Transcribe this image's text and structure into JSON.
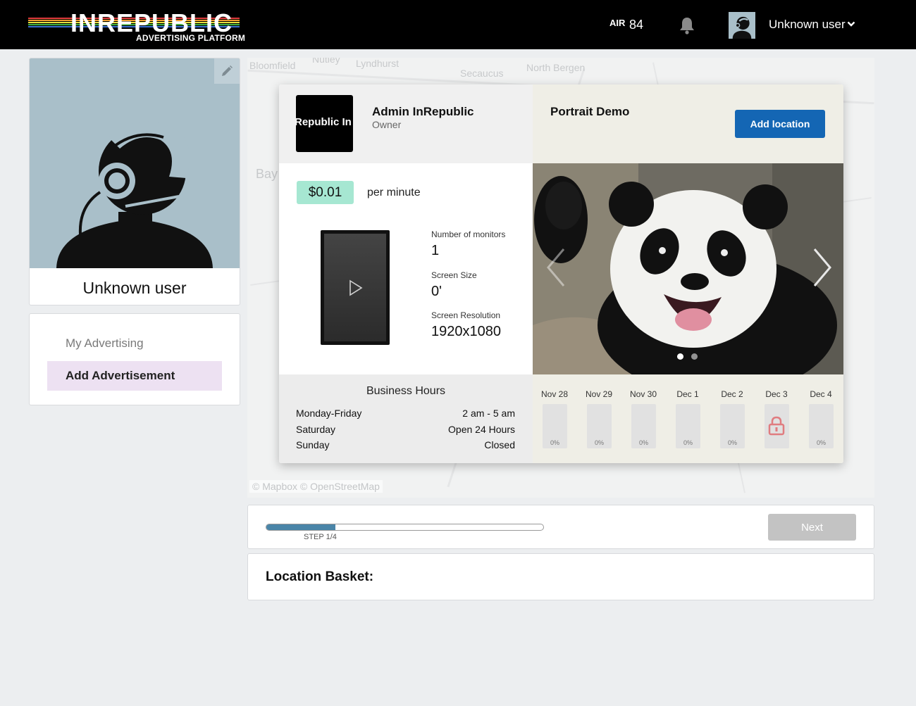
{
  "header": {
    "logo_text": "INREPUBLIC",
    "logo_subtitle": "ADVERTISING PLATFORM",
    "air_label": "AIR",
    "air_value": "84",
    "user_name": "Unknown user",
    "icons": [
      "bell-icon",
      "chevron-down-icon"
    ],
    "logo_stripe_colors": [
      "#e03a3a",
      "#f0a030",
      "#e8e040",
      "#40b040",
      "#3a70d0",
      "#8040c0",
      "#ffffff"
    ]
  },
  "profile": {
    "name": "Unknown user",
    "avatar_bg": "#a9bfc9",
    "icons": [
      "pencil-icon",
      "astronaut-avatar-icon"
    ]
  },
  "menu": {
    "items": [
      {
        "label": "My Advertising",
        "active": false
      },
      {
        "label": "Add Advertisement",
        "active": true
      }
    ]
  },
  "map": {
    "places": [
      "Bloomfield",
      "Nutley",
      "Lyndhurst",
      "Secaucus",
      "North Bergen",
      "Bay"
    ],
    "credit": "© Mapbox © OpenStreetMap"
  },
  "location": {
    "owner_name": "Admin InRepublic",
    "owner_role": "Owner",
    "owner_logo_text": "Republic In",
    "name": "Portrait Demo",
    "add_button": "Add location",
    "price": "$0.01",
    "price_unit": "per minute",
    "specs": [
      {
        "label": "Number of monitors",
        "value": "1"
      },
      {
        "label": "Screen Size",
        "value": "0'"
      },
      {
        "label": "Screen Resolution",
        "value": "1920x1080"
      }
    ],
    "business_hours": {
      "title": "Business Hours",
      "rows": [
        {
          "day": "Monday-Friday",
          "time": "2 am - 5 am"
        },
        {
          "day": "Saturday",
          "time": "Open 24 Hours"
        },
        {
          "day": "Sunday",
          "time": "Closed"
        }
      ]
    },
    "carousel": {
      "slides": 2,
      "active": 1
    },
    "calendar": [
      {
        "label": "Nov 28",
        "pct": "0%",
        "locked": false
      },
      {
        "label": "Nov 29",
        "pct": "0%",
        "locked": false
      },
      {
        "label": "Nov 30",
        "pct": "0%",
        "locked": false
      },
      {
        "label": "Dec 1",
        "pct": "0%",
        "locked": false
      },
      {
        "label": "Dec 2",
        "pct": "0%",
        "locked": false
      },
      {
        "label": "Dec 3",
        "pct": "",
        "locked": true
      },
      {
        "label": "Dec 4",
        "pct": "0%",
        "locked": false
      }
    ]
  },
  "steps": {
    "label": "STEP 1/4",
    "progress": 0.25,
    "next_button": "Next",
    "fill_color": "#4a85a8"
  },
  "basket": {
    "title": "Location Basket:"
  }
}
